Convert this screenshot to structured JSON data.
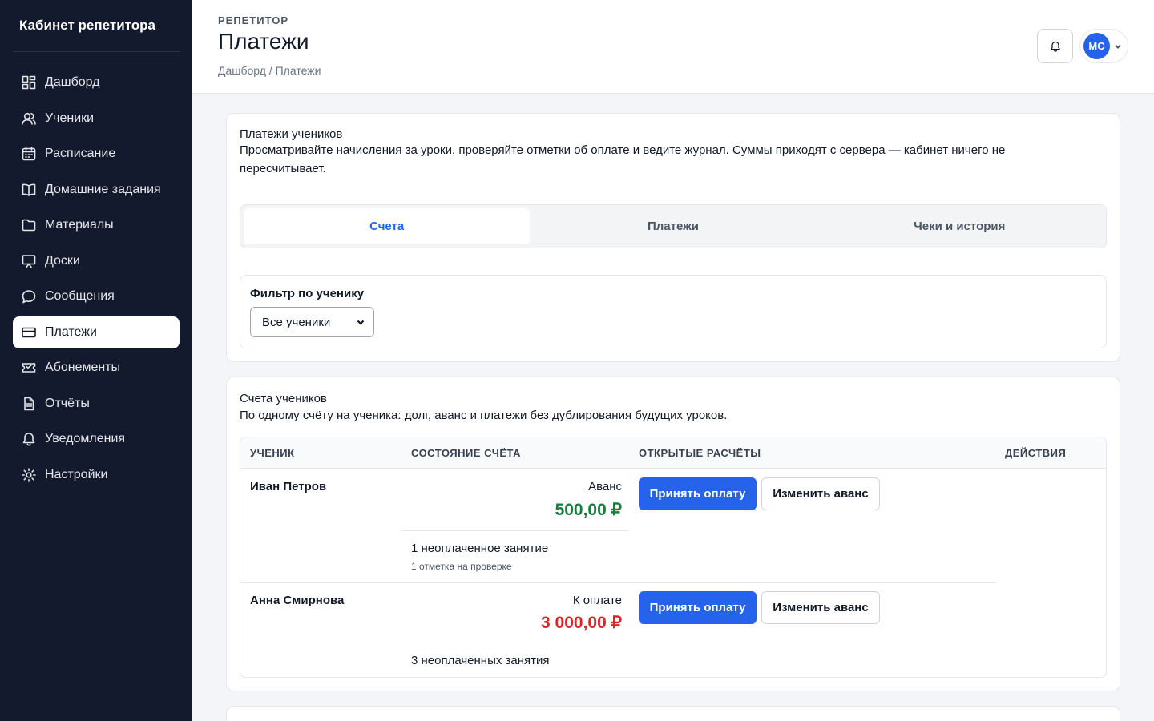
{
  "sidebar": {
    "brand": "Кабинет репетитора",
    "items": [
      {
        "label": "Дашборд",
        "icon": "dashboard-icon"
      },
      {
        "label": "Ученики",
        "icon": "users-icon"
      },
      {
        "label": "Расписание",
        "icon": "calendar-icon"
      },
      {
        "label": "Домашние задания",
        "icon": "book-icon"
      },
      {
        "label": "Материалы",
        "icon": "folder-icon"
      },
      {
        "label": "Доски",
        "icon": "board-icon"
      },
      {
        "label": "Сообщения",
        "icon": "message-icon"
      },
      {
        "label": "Платежи",
        "icon": "card-icon",
        "active": true
      },
      {
        "label": "Абонементы",
        "icon": "ticket-icon"
      },
      {
        "label": "Отчёты",
        "icon": "report-icon"
      },
      {
        "label": "Уведомления",
        "icon": "bell-icon"
      },
      {
        "label": "Настройки",
        "icon": "gear-icon"
      }
    ]
  },
  "header": {
    "eyebrow": "РЕПЕТИТОР",
    "title": "Платежи",
    "breadcrumb": "Дашборд / Платежи",
    "user_initials": "МС"
  },
  "payments_card": {
    "title": "Платежи учеников",
    "description": "Просматривайте начисления за уроки, проверяйте отметки об оплате и ведите журнал. Суммы приходят с сервера — кабинет ничего не пересчитывает.",
    "tabs": [
      "Счета",
      "Платежи",
      "Чеки и история"
    ],
    "filter_label": "Фильтр по ученику",
    "filter_value": "Все ученики"
  },
  "accounts_card": {
    "title": "Счета учеников",
    "description": "По одному счёту на ученика: долг, аванс и платежи без дублирования будущих уроков.",
    "columns": [
      "УЧЕНИК",
      "СОСТОЯНИЕ СЧЁТА",
      "ОТКРЫТЫЕ РАСЧЁТЫ",
      "ДЕЙСТВИЯ"
    ],
    "rows": [
      {
        "student": "Иван Петров",
        "state_label": "Аванс",
        "amount": "500,00 ₽",
        "unpaid": "1 неоплаченное занятие",
        "review": "1 отметка на проверке",
        "accept_label": "Принять оплату",
        "edit_label": "Изменить аванс"
      },
      {
        "student": "Анна Смирнова",
        "state_label": "К оплате",
        "amount": "3 000,00 ₽",
        "unpaid": "3 неоплаченных занятия",
        "review": "",
        "accept_label": "Принять оплату",
        "edit_label": "Изменить аванс"
      }
    ]
  },
  "colors": {
    "sidebar_bg": "#131a2d",
    "accent": "#2563eb",
    "advance_green": "#15803d",
    "debt_red": "#dc2626"
  }
}
